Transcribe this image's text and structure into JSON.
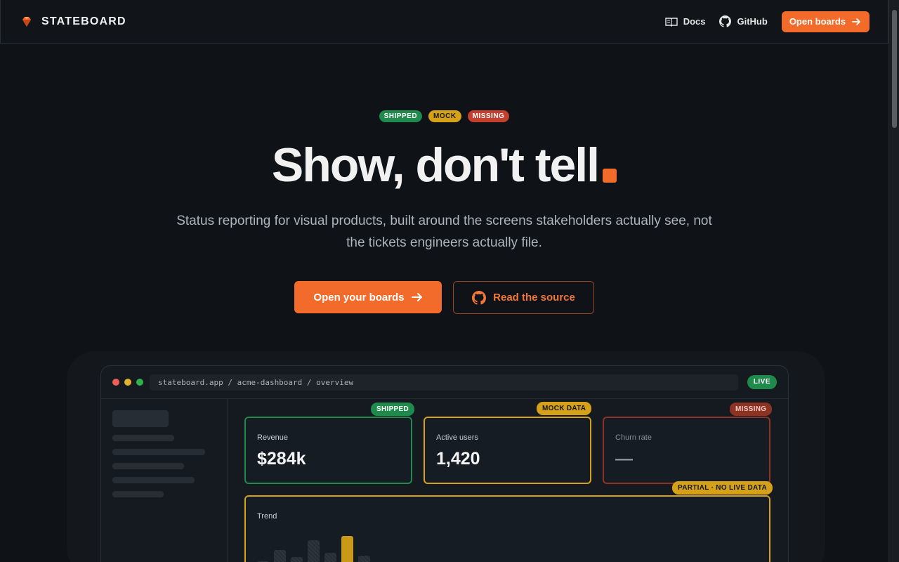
{
  "nav": {
    "brand": "STATEBOARD",
    "docs_label": "Docs",
    "github_label": "GitHub",
    "cta_label": "Open boards"
  },
  "hero": {
    "badges": [
      "SHIPPED",
      "MOCK",
      "MISSING"
    ],
    "headline": "Show, don't tell",
    "subtitle": "Status reporting for visual products, built around the screens stakeholders actually see, not the tickets engineers actually file.",
    "primary_cta": "Open your boards",
    "secondary_cta": "Read the source"
  },
  "mock": {
    "url": "stateboard.app / acme-dashboard / overview",
    "live_badge": "LIVE",
    "cards": [
      {
        "status": "SHIPPED",
        "label": "Revenue",
        "value": "$284k"
      },
      {
        "status": "MOCK DATA",
        "label": "Active users",
        "value": "1,420"
      },
      {
        "status": "MISSING",
        "label": "Churn rate",
        "value": "—"
      }
    ],
    "trend": {
      "status": "PARTIAL · NO LIVE DATA",
      "label": "Trend"
    }
  },
  "colors": {
    "accent": "#f26b2a",
    "shipped": "#1f8a4c",
    "mock": "#d4a118",
    "missing": "#c2402d",
    "background": "#0f1216"
  },
  "icons": {
    "brand": "gem-icon",
    "docs": "book-icon",
    "github": "github-icon",
    "arrow": "arrow-right-icon"
  }
}
